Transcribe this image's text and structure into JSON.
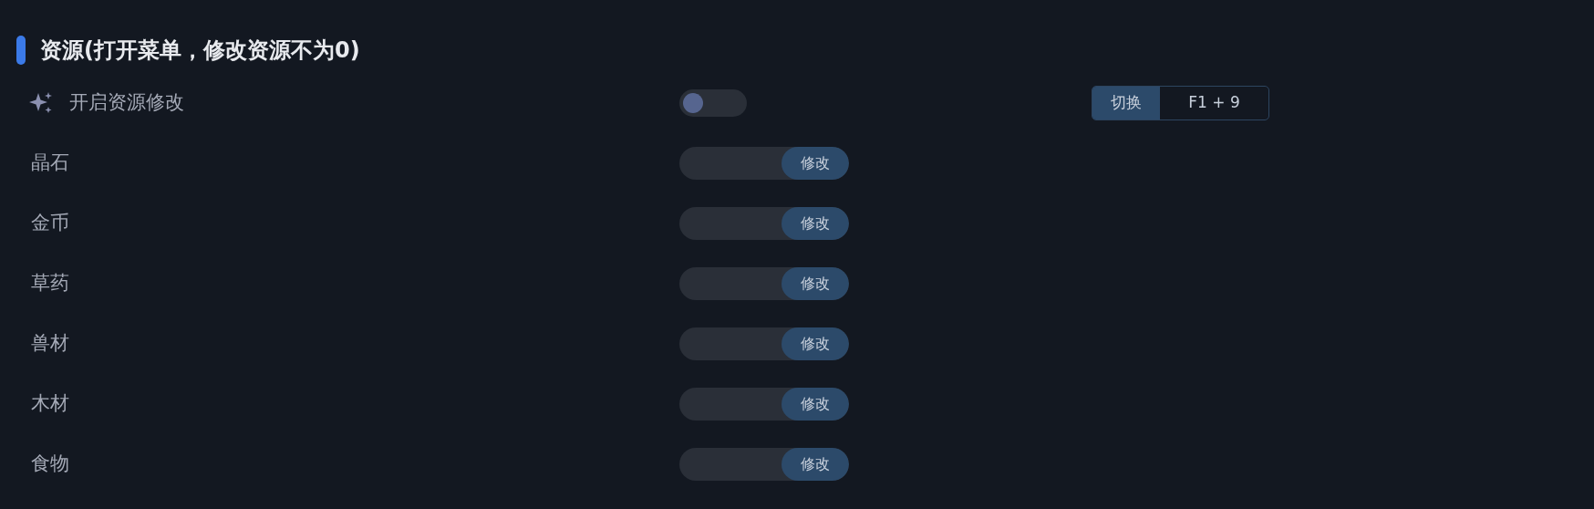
{
  "section": {
    "title": "资源(打开菜单，修改资源不为0)"
  },
  "master": {
    "label": "开启资源修改",
    "on": false,
    "hotkey": {
      "label": "切换",
      "keys": "F1 + 9"
    }
  },
  "resources": [
    {
      "name": "晶石",
      "button": "修改"
    },
    {
      "name": "金币",
      "button": "修改"
    },
    {
      "name": "草药",
      "button": "修改"
    },
    {
      "name": "兽材",
      "button": "修改"
    },
    {
      "name": "木材",
      "button": "修改"
    },
    {
      "name": "食物",
      "button": "修改"
    }
  ]
}
